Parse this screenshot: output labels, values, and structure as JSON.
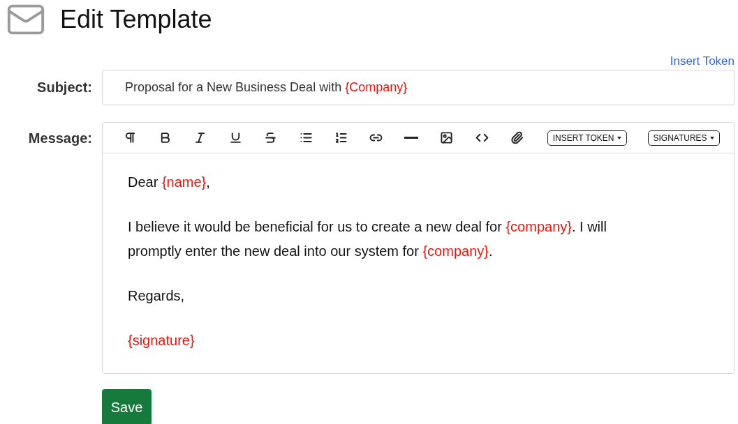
{
  "header": {
    "title": "Edit Template"
  },
  "insert_token_link": "Insert Token",
  "subject": {
    "label": "Subject:",
    "value": [
      {
        "kind": "text",
        "text": "Proposal for a New Business Deal with "
      },
      {
        "kind": "token",
        "text": "{Company}"
      }
    ]
  },
  "message": {
    "label": "Message:",
    "toolbar_dropdowns": [
      "INSERT TOKEN",
      "SIGNATURES"
    ],
    "paragraphs": [
      [
        {
          "kind": "text",
          "text": "Dear "
        },
        {
          "kind": "token",
          "text": "{name}"
        },
        {
          "kind": "text",
          "text": ","
        }
      ],
      [
        {
          "kind": "text",
          "text": "I believe it would be beneficial for us to create a new deal for "
        },
        {
          "kind": "token",
          "text": "{company}"
        },
        {
          "kind": "text",
          "text": ". I will promptly enter the new deal into our system for "
        },
        {
          "kind": "token",
          "text": "{company}"
        },
        {
          "kind": "text",
          "text": "."
        }
      ],
      [
        {
          "kind": "text",
          "text": "Regards,"
        }
      ],
      [
        {
          "kind": "token",
          "text": "{signature}"
        }
      ]
    ]
  },
  "save_button": "Save"
}
